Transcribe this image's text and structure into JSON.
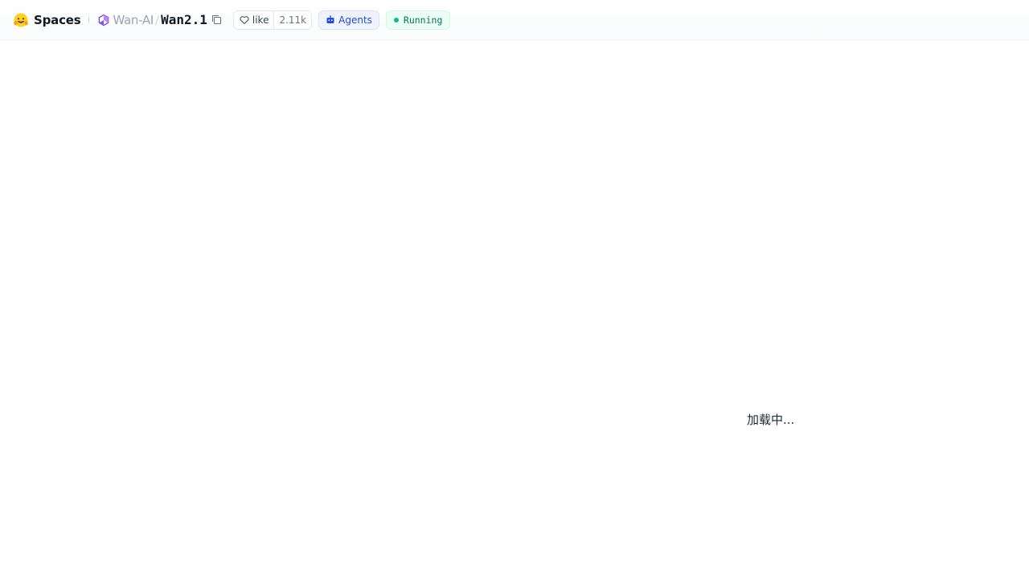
{
  "header": {
    "brand_label": "Spaces",
    "org_name": "Wan-AI",
    "separator": "/",
    "repo_name": "Wan2.1",
    "like_label": "like",
    "like_count": "2.11k",
    "agents_label": "Agents",
    "status_label": "Running"
  },
  "main": {
    "loading_text": "加载中..."
  },
  "colors": {
    "status_green": "#10b981",
    "agents_blue": "#1d4ed8",
    "org_avatar_purple": "#7c3aed"
  },
  "icons": {
    "brand": "hugging-face-icon",
    "org": "org-avatar-icon",
    "copy": "copy-icon",
    "like": "heart-icon",
    "agents": "robot-icon",
    "status": "status-dot-icon"
  }
}
